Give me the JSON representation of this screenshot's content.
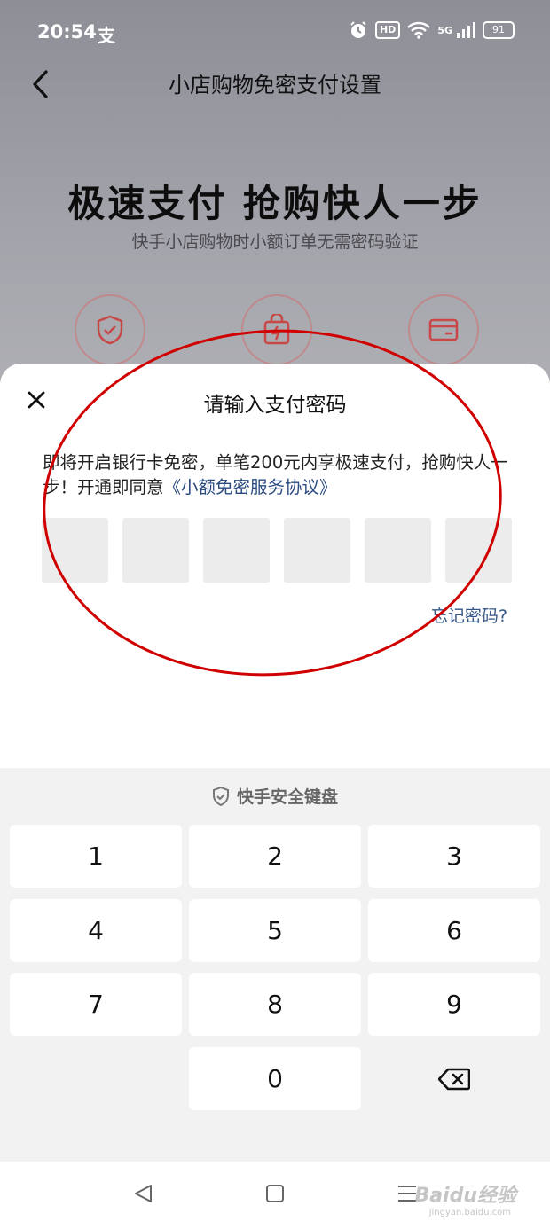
{
  "status_bar": {
    "time": "20:54",
    "alipay_glyph": "支",
    "hd": "HD",
    "network": "5G",
    "battery": "91"
  },
  "header": {
    "title": "小店购物免密支付设置"
  },
  "hero": {
    "title": "极速支付 抢购快人一步",
    "subtitle": "快手小店购物时小额订单无需密码验证"
  },
  "features": [
    "shield-check-icon",
    "bag-lightning-icon",
    "card-icon"
  ],
  "sheet": {
    "title": "请输入支付密码",
    "desc_text": "即将开启银行卡免密，单笔200元内享极速支付，抢购快人一步！开通即同意",
    "agreement_link": "《小额免密服务协议》",
    "forgot": "忘记密码?"
  },
  "keyboard": {
    "title": "快手安全键盘",
    "keys": [
      "1",
      "2",
      "3",
      "4",
      "5",
      "6",
      "7",
      "8",
      "9",
      "0"
    ]
  },
  "watermark": {
    "brand": "Baidu经验",
    "url": "jingyan.baidu.com"
  },
  "colors": {
    "link": "#2a4b80",
    "annotation": "#d00000",
    "key_bg": "#ffffff",
    "keyboard_bg": "#f2f2f2"
  }
}
